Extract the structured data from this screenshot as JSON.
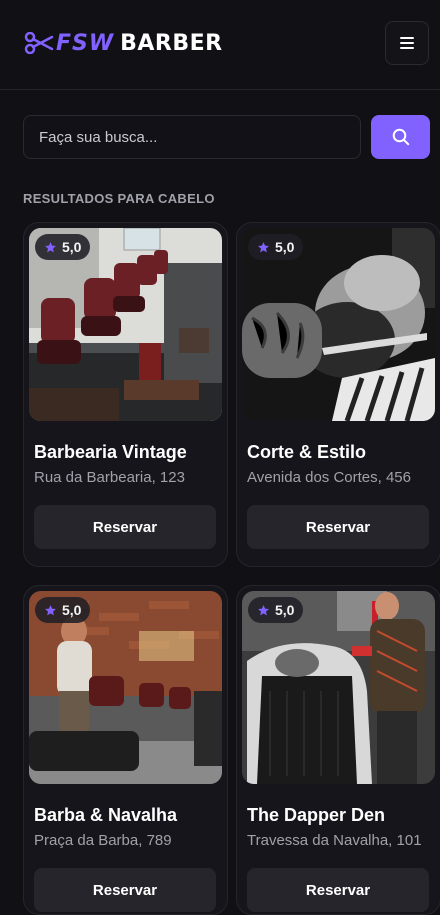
{
  "header": {
    "logo_fsw": "FSW",
    "logo_barber": "BARBER",
    "menu_icon": "hamburger-menu-icon"
  },
  "search": {
    "placeholder": "Faça sua busca...",
    "button_icon": "search-icon"
  },
  "section_title": "RESULTADOS PARA CABELO",
  "colors": {
    "accent": "#8162ff",
    "background": "#111015",
    "card": "#16151b",
    "muted_text": "#a1a1aa"
  },
  "barbershops": [
    {
      "name": "Barbearia Vintage",
      "address": "Rua da Barbearia, 123",
      "rating": "5,0",
      "button": "Reservar"
    },
    {
      "name": "Corte & Estilo",
      "address": "Avenida dos Cortes, 456",
      "rating": "5,0",
      "button": "Reservar"
    },
    {
      "name": "Barba & Navalha",
      "address": "Praça da Barba, 789",
      "rating": "5,0",
      "button": "Reservar"
    },
    {
      "name": "The Dapper Den",
      "address": "Travessa da Navalha, 101",
      "rating": "5,0",
      "button": "Reservar"
    }
  ]
}
